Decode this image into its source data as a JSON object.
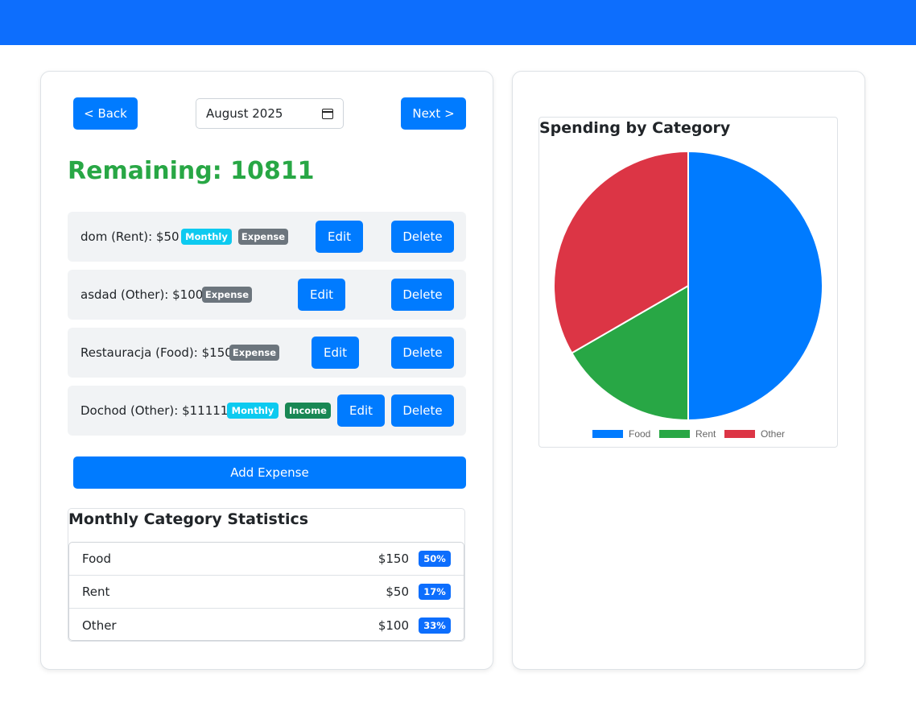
{
  "nav": {
    "back_label": "< Back",
    "next_label": "Next >",
    "month_value": "August 2025"
  },
  "summary": {
    "remaining_text": "Remaining: 10811"
  },
  "expenses": [
    {
      "text": "dom (Rent): $50",
      "badges": [
        "Monthly",
        "Expense"
      ],
      "edit_label": "Edit",
      "delete_label": "Delete"
    },
    {
      "text": "asdad (Other): $100",
      "badges": [
        "Expense"
      ],
      "edit_label": "Edit",
      "delete_label": "Delete"
    },
    {
      "text": "Restauracja (Food): $150",
      "badges": [
        "Expense"
      ],
      "edit_label": "Edit",
      "delete_label": "Delete"
    },
    {
      "text": "Dochod (Other): $11111",
      "badges": [
        "Monthly",
        "Income"
      ],
      "edit_label": "Edit",
      "delete_label": "Delete"
    }
  ],
  "add_button_label": "Add Expense",
  "stats": {
    "title": "Monthly Category Statistics",
    "rows": [
      {
        "name": "Food",
        "amount": "$150",
        "percent": "50%"
      },
      {
        "name": "Rent",
        "amount": "$50",
        "percent": "17%"
      },
      {
        "name": "Other",
        "amount": "$100",
        "percent": "33%"
      }
    ]
  },
  "chart_data": {
    "type": "pie",
    "title": "Spending by Category",
    "categories": [
      "Food",
      "Rent",
      "Other"
    ],
    "values": [
      150,
      50,
      100
    ],
    "colors": [
      "#007bff",
      "#28a745",
      "#dc3545"
    ],
    "legend_position": "bottom"
  },
  "colors": {
    "primary": "#007bff",
    "topbar": "#0d6efd",
    "remaining": "#28a745",
    "badge_monthly": "#0dcaf0",
    "badge_expense": "#6c757d",
    "badge_income": "#198754"
  }
}
